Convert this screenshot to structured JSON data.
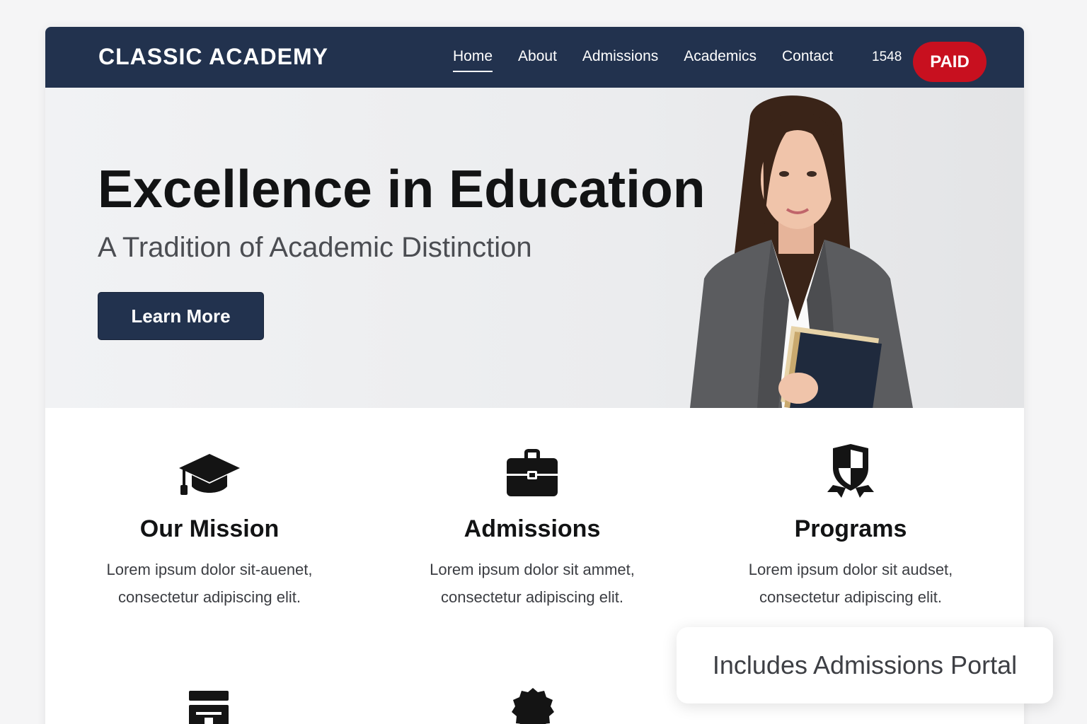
{
  "navbar": {
    "brand": "CLASSIC ACADEMY",
    "links": [
      {
        "label": "Home",
        "active": true
      },
      {
        "label": "About"
      },
      {
        "label": "Admissions"
      },
      {
        "label": "Academics"
      },
      {
        "label": "Contact"
      }
    ],
    "code_text": "1548",
    "badge": "PAID"
  },
  "hero": {
    "title": "Excellence in Education",
    "subtitle": "A Tradition of Academic Distinction",
    "cta_label": "Learn More"
  },
  "features": [
    {
      "icon": "graduation-cap-icon",
      "title": "Our Mission",
      "line1": "Lorem ipsum dolor sit-auenet,",
      "line2": "consectetur adipiscing elit."
    },
    {
      "icon": "briefcase-icon",
      "title": "Admissions",
      "line1": "Lorem ipsum dolor sit ammet,",
      "line2": "consectetur adipiscing elit."
    },
    {
      "icon": "shield-award-icon",
      "title": "Programs",
      "line1": "Lorem ipsum dolor sit audset,",
      "line2": "consectetur adipiscing elit."
    }
  ],
  "bottom_icons": [
    "building-icon",
    "award-ribbon-icon"
  ],
  "toast": {
    "text": "Includes Admissions Portal"
  },
  "colors": {
    "navy": "#22324e",
    "badge_red": "#c8101f",
    "text_dark": "#121314"
  }
}
